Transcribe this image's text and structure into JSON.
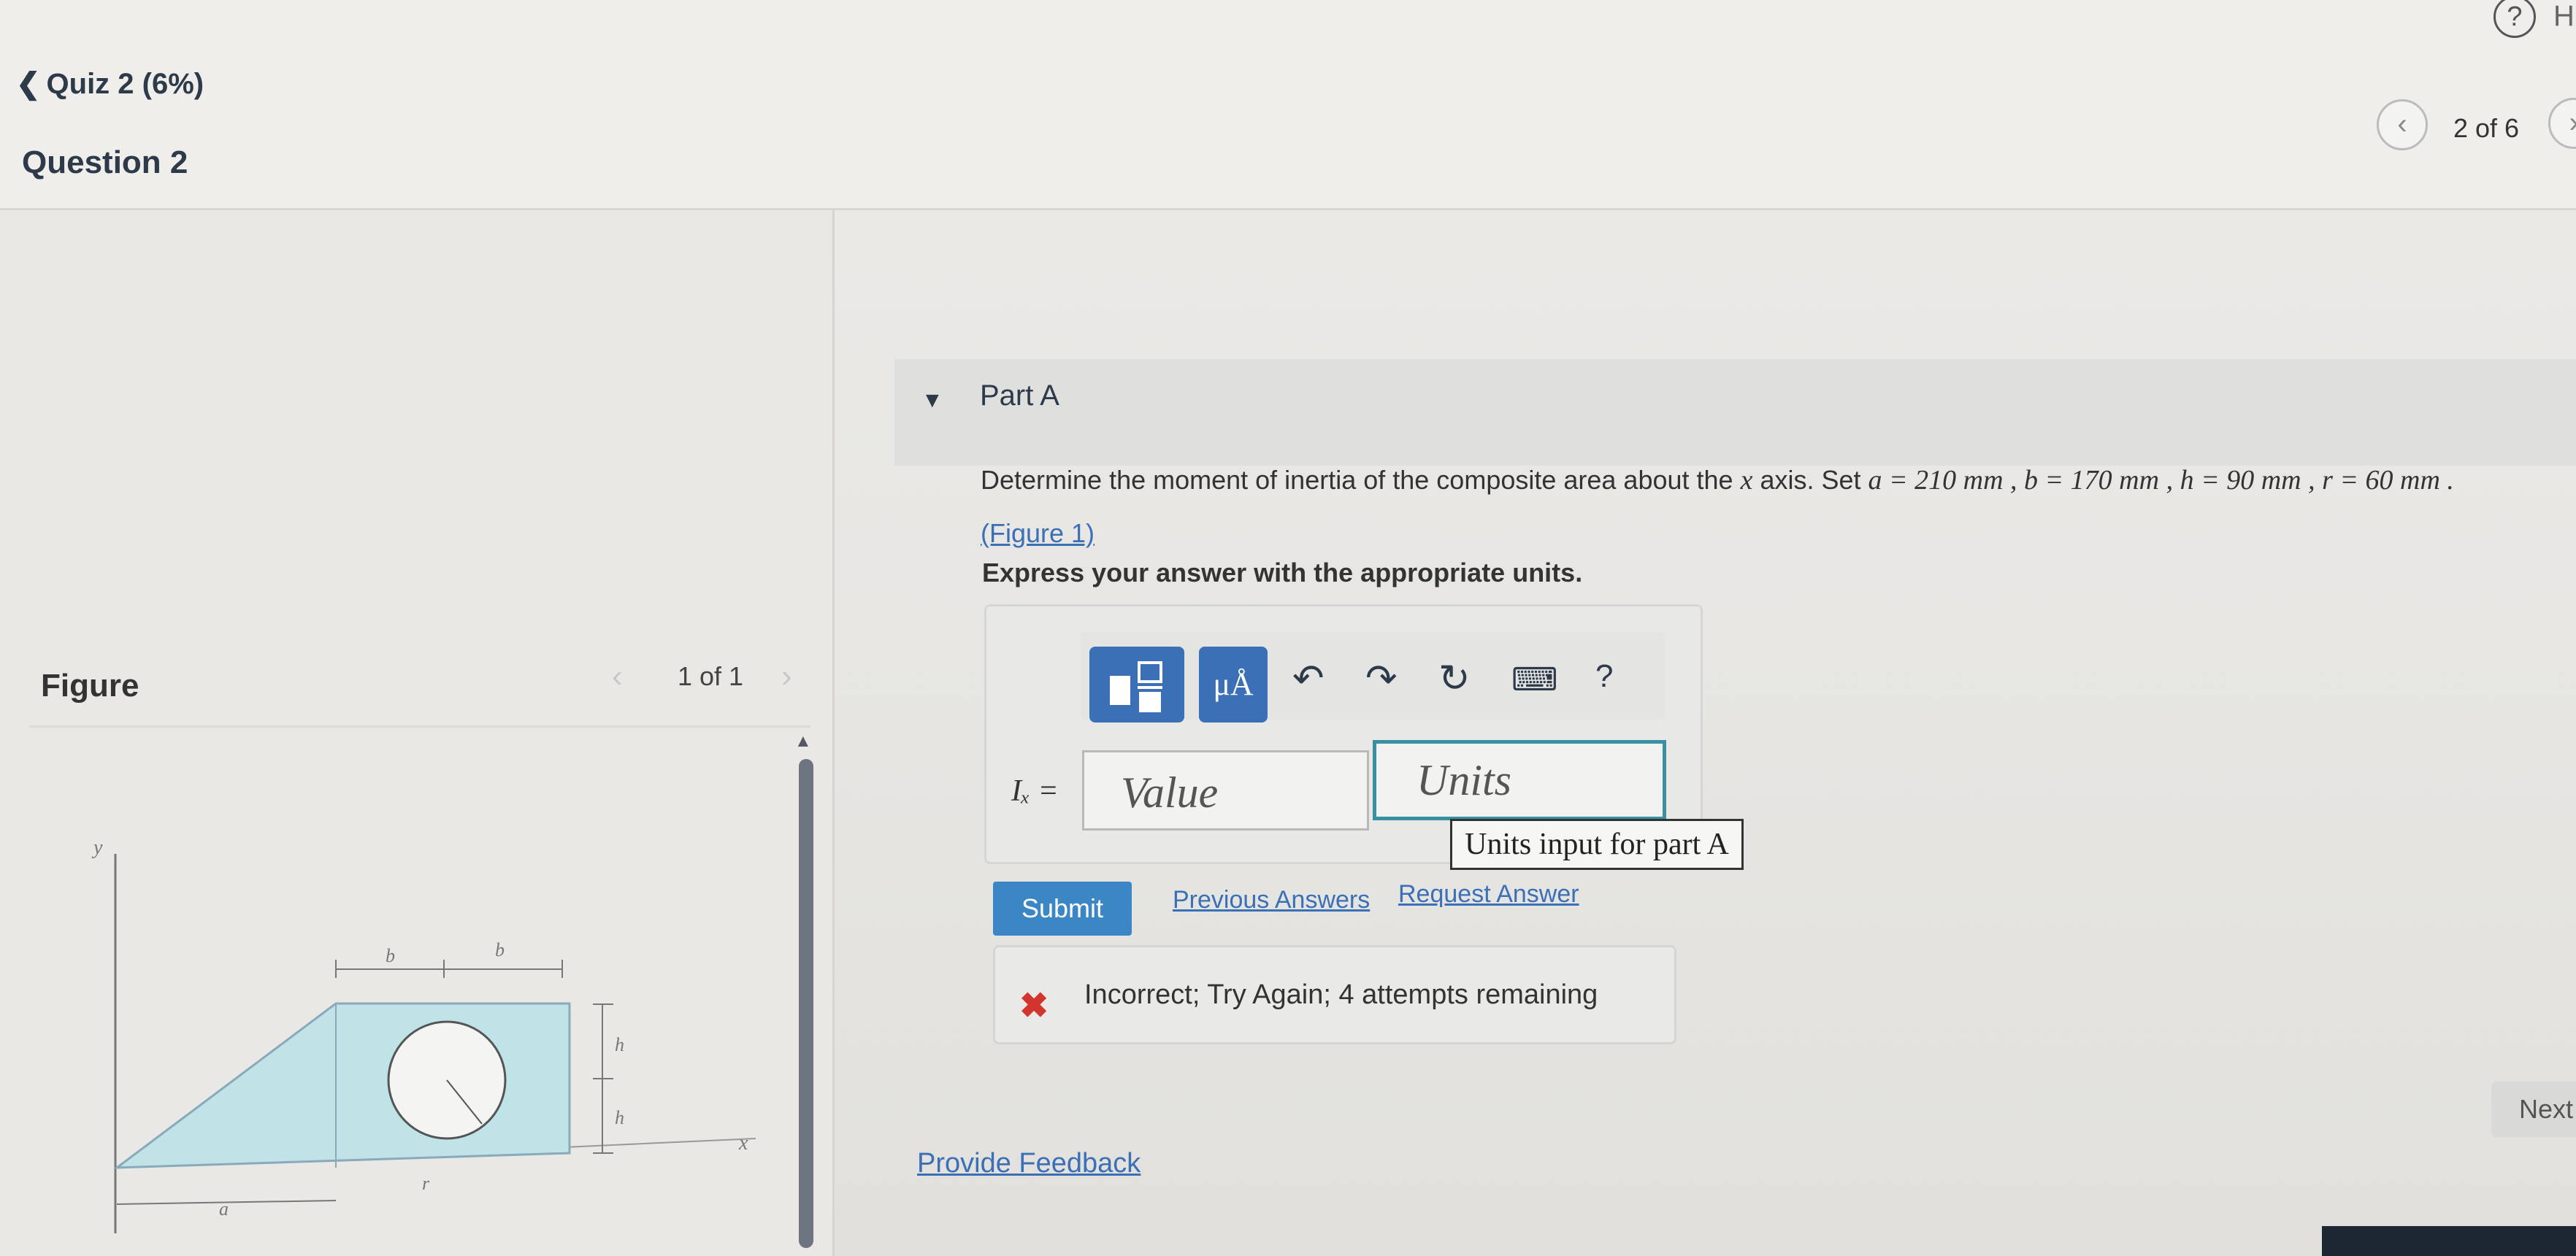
{
  "header": {
    "back_link": "Quiz 2 (6%)",
    "question_title": "Question 2",
    "help_icon_text": "?",
    "help_text": "H",
    "pager": "2 of 6"
  },
  "figure_panel": {
    "label": "Figure",
    "pager": "1 of 1",
    "labels": {
      "y": "y",
      "x": "x",
      "b1": "b",
      "b2": "b",
      "h1": "h",
      "h2": "h",
      "a": "a",
      "r": "r"
    }
  },
  "partA": {
    "title": "Part A",
    "question_prefix": "Determine the moment of inertia of the composite area about the ",
    "question_axis": "x",
    "question_mid": " axis. Set ",
    "params": "a = 210 mm , b = 170 mm , h = 90 mm , r = 60 mm .",
    "figure_link": "(Figure 1)",
    "express": "Express your answer with the appropriate units."
  },
  "answer": {
    "label": "Iₓ =",
    "value_placeholder": "Value",
    "units_placeholder": "Units",
    "tooltip": "Units input for part A",
    "toolbar": {
      "units_button": "μÅ",
      "help_button": "?"
    }
  },
  "actions": {
    "submit": "Submit",
    "previous_answers": "Previous Answers",
    "request_answer": "Request Answer"
  },
  "feedback": {
    "text": "Incorrect; Try Again; 4 attempts remaining"
  },
  "footer": {
    "provide_feedback": "Provide Feedback",
    "next": "Next"
  },
  "colors": {
    "accent": "#3b6fb6",
    "submit": "#3b86c4",
    "error": "#d2342e",
    "figure_fill": "#bfe3e6"
  }
}
